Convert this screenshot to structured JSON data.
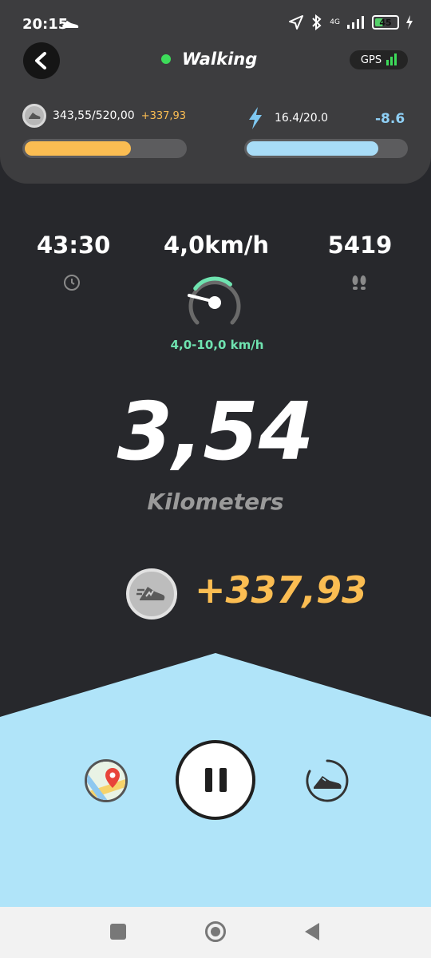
{
  "status": {
    "time": "20:15",
    "network": "4G",
    "battery": "45",
    "battery_level": 0.45
  },
  "header": {
    "mode_label": "Walking",
    "gps_label": "GPS",
    "mode_color": "#3ddc5a"
  },
  "progress": {
    "coins": "343,55/520,00",
    "coins_gain": "+337,93",
    "coins_fill": 0.66,
    "energy": "16.4/20.0",
    "energy_delta": "-8.6",
    "energy_fill": 0.82,
    "coin_bar_color": "#fbbd52",
    "energy_bar_color": "#a8dcf7"
  },
  "stats": {
    "duration": "43:30",
    "speed": "4,0km/h",
    "steps": "5419",
    "speed_range": "4,0-10,0 km/h",
    "gauge_level": 0.35
  },
  "distance": {
    "value": "3,54",
    "unit": "Kilometers"
  },
  "earnings": {
    "value": "+337,93"
  },
  "icons": [
    "back-arrow-icon",
    "clock-icon",
    "footsteps-icon",
    "speedometer-icon",
    "coin-icon",
    "lightning-icon",
    "map-pin-icon",
    "pause-icon",
    "sneaker-icon"
  ]
}
